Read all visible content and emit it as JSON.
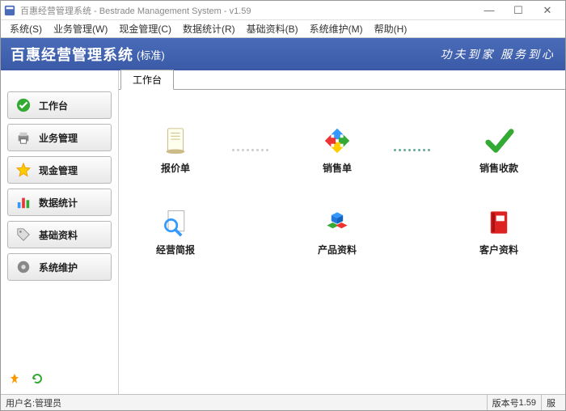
{
  "window": {
    "title": "百惠经营管理系统 - Bestrade Management System - v1.59"
  },
  "menu": {
    "items": [
      "系统(S)",
      "业务管理(W)",
      "现金管理(C)",
      "数据统计(R)",
      "基础资料(B)",
      "系统维护(M)",
      "帮助(H)"
    ]
  },
  "brand": {
    "title": "百惠经营管理系统",
    "sub": "(标准)",
    "slogan": "功夫到家 服务到心"
  },
  "sidebar": {
    "items": [
      {
        "label": "工作台"
      },
      {
        "label": "业务管理"
      },
      {
        "label": "现金管理"
      },
      {
        "label": "数据统计"
      },
      {
        "label": "基础资料"
      },
      {
        "label": "系统维护"
      }
    ]
  },
  "tabs": {
    "active": "工作台"
  },
  "tiles": {
    "row1": [
      {
        "label": "报价单"
      },
      {
        "label": "销售单"
      },
      {
        "label": "销售收款"
      }
    ],
    "row2": [
      {
        "label": "经营简报"
      },
      {
        "label": "产品资料"
      },
      {
        "label": "客户资料"
      }
    ]
  },
  "status": {
    "user_label": "用户名:",
    "user_value": "管理员",
    "version_label": "版本号",
    "version_value": "1.59",
    "extra": "服"
  }
}
